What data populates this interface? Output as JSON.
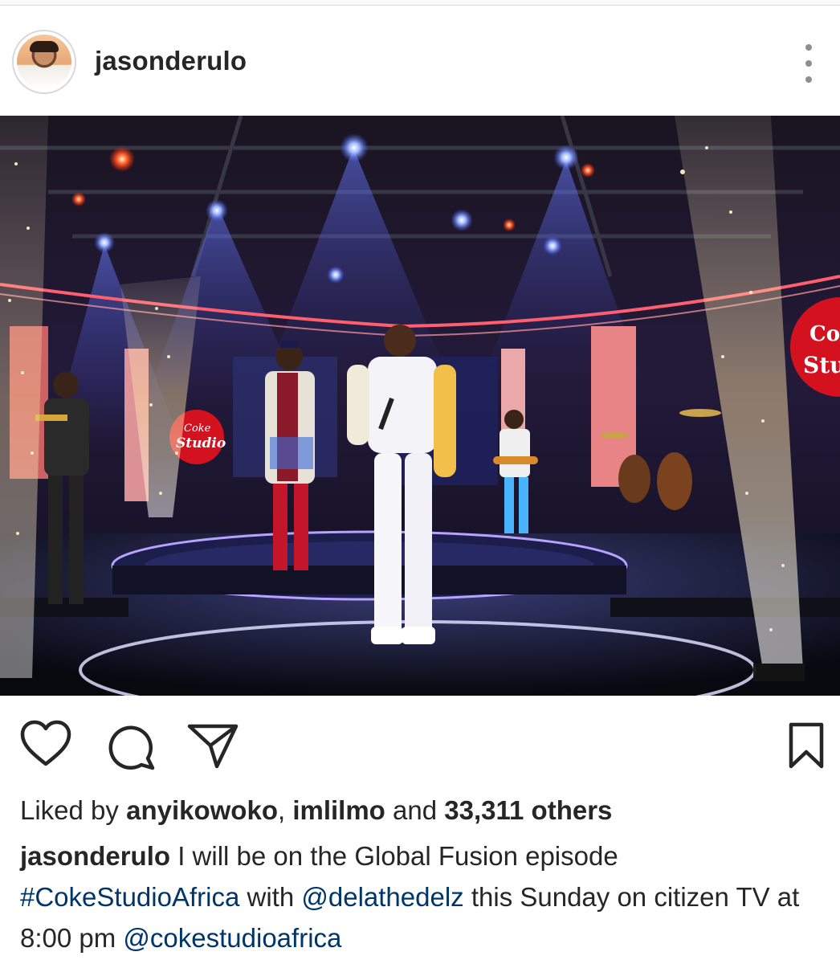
{
  "post": {
    "username": "jasonderulo",
    "image_logo_text_1": "Coke",
    "image_logo_text_2": "Studio",
    "image_logo_text_right": "Co Stu"
  },
  "likes": {
    "prefix": "Liked by",
    "user1": "anyikowoko",
    "separator": ",",
    "user2": "imlilmo",
    "and": "and",
    "count": "33,311 others"
  },
  "caption": {
    "username": "jasonderulo",
    "text1": "I will be on the Global Fusion episode",
    "hashtag": "#CokeStudioAfrica",
    "text2": "with",
    "mention1": "@delathedelz",
    "text3": "this Sunday on citizen TV at 8:00 pm",
    "mention2": "@cokestudioafrica"
  },
  "icons": {
    "like": "heart-icon",
    "comment": "comment-icon",
    "share": "share-icon",
    "save": "bookmark-icon",
    "more": "more-vertical-icon"
  },
  "colors": {
    "text": "#262626",
    "link": "#003569",
    "muted": "#8e8e8e"
  }
}
